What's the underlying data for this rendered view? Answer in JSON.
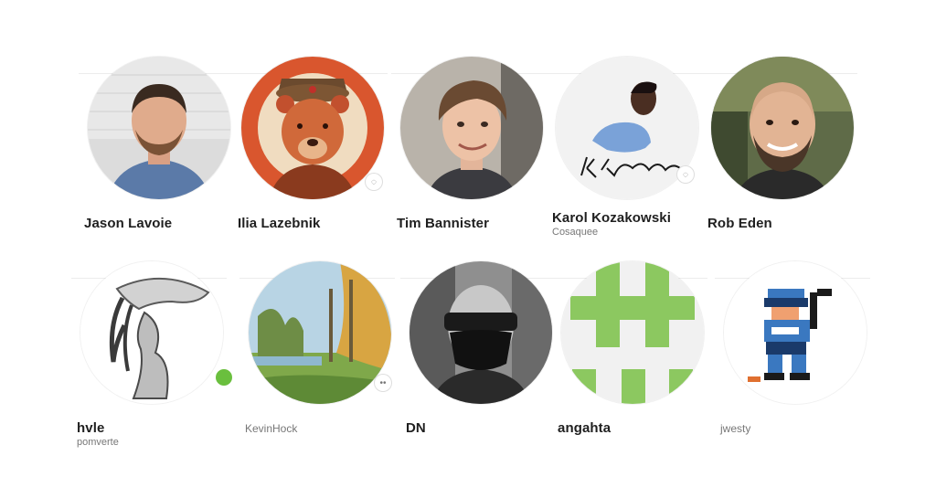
{
  "profiles": [
    {
      "name": "Jason Lavoie",
      "handle": "",
      "avatar_icon": "person-photo-icon"
    },
    {
      "name": "Ilia Lazebnik",
      "handle": "",
      "avatar_icon": "bear-illustration-icon",
      "badge_icon": "chat-bubble-icon"
    },
    {
      "name": "Tim Bannister",
      "handle": "",
      "avatar_icon": "person-photo-icon"
    },
    {
      "name": "Karol Kozakowski",
      "handle": "Cosaquee",
      "avatar_icon": "sketch-signature-icon",
      "badge_icon": "chat-bubble-icon"
    },
    {
      "name": "Rob Eden",
      "handle": "",
      "avatar_icon": "person-photo-icon"
    },
    {
      "name": "hvle",
      "handle": "pomverte",
      "avatar_icon": "creature-drawing-icon",
      "badge_icon": "green-apple-icon"
    },
    {
      "name": "",
      "handle": "KevinHock",
      "avatar_icon": "landscape-painting-icon",
      "badge_icon": "eyes-icon"
    },
    {
      "name": "DN",
      "handle": "",
      "avatar_icon": "masked-person-icon"
    },
    {
      "name": "angahta",
      "handle": "",
      "avatar_icon": "green-identicon-icon"
    },
    {
      "name": "",
      "handle": "jwesty",
      "avatar_icon": "pixel-hockey-player-icon"
    }
  ],
  "colors": {
    "identicon_green": "#8cc860",
    "name_text": "#1f1f1f",
    "handle_text": "#777777"
  }
}
